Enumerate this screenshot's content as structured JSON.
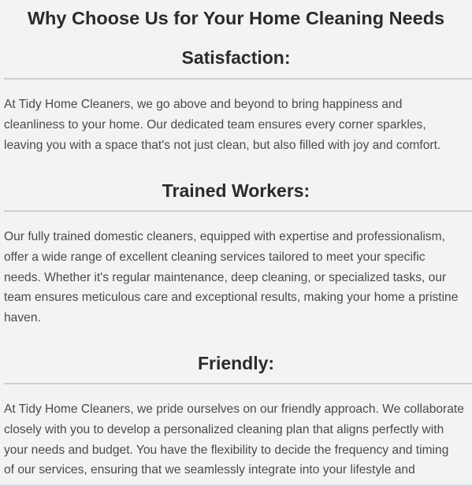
{
  "page_title": "Why Choose Us for Your Home Cleaning Needs",
  "sections": [
    {
      "heading": "Satisfaction:",
      "lines": [
        "At Tidy Home Cleaners, we go above and beyond to bring happiness and",
        "cleanliness to your home. Our dedicated team ensures every corner sparkles,",
        "leaving you with a space that's not just clean, but also filled with joy and comfort."
      ]
    },
    {
      "heading": "Trained Workers:",
      "lines": [
        "Our fully trained domestic cleaners, equipped with expertise and professionalism,",
        "offer a wide range of excellent cleaning services tailored to meet your specific",
        "needs. Whether it's regular maintenance, deep cleaning, or specialized tasks, our",
        "team ensures meticulous care and exceptional results, making your home a pristine",
        "haven."
      ]
    },
    {
      "heading": "Friendly:",
      "lines": [
        "At Tidy Home Cleaners, we pride ourselves on our friendly approach. We collaborate",
        "closely with you to develop a personalized cleaning plan that aligns perfectly with",
        "your needs and budget. You have the flexibility to decide the frequency and timing",
        "of our services, ensuring that we seamlessly integrate into your lifestyle and"
      ]
    }
  ]
}
